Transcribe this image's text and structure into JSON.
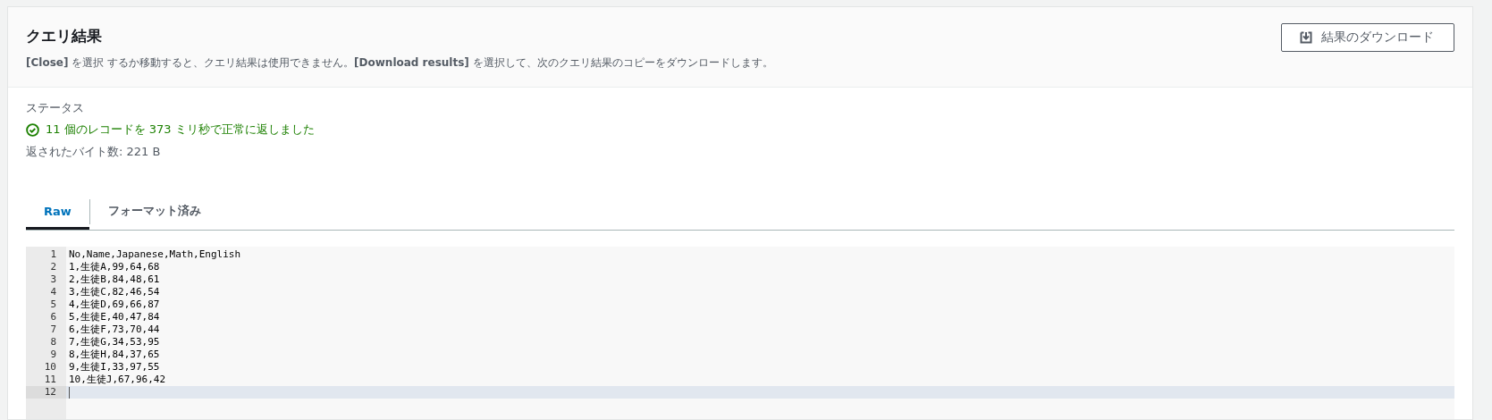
{
  "header": {
    "title": "クエリ結果",
    "description": "**[Close]** を選択 するか移動すると、クエリ結果は使用できません。**[Download results]** を選択して、次のクエリ結果のコピーをダウンロードします。",
    "download_button": "結果のダウンロード"
  },
  "status": {
    "label": "ステータス",
    "message": "11 個のレコードを 373 ミリ秒で正常に返しました",
    "success": true,
    "bytes": "返されたバイト数: 221 B"
  },
  "tabs": [
    {
      "label": "Raw",
      "selected": true
    },
    {
      "label": "フォーマット済み",
      "selected": false
    }
  ],
  "editor": {
    "lines": [
      {
        "number": "1",
        "text": "No,Name,Japanese,Math,English",
        "active": false
      },
      {
        "number": "2",
        "text": "1,生徒A,99,64,68",
        "active": false
      },
      {
        "number": "3",
        "text": "2,生徒B,84,48,61",
        "active": false
      },
      {
        "number": "4",
        "text": "3,生徒C,82,46,54",
        "active": false
      },
      {
        "number": "5",
        "text": "4,生徒D,69,66,87",
        "active": false
      },
      {
        "number": "6",
        "text": "5,生徒E,40,47,84",
        "active": false
      },
      {
        "number": "7",
        "text": "6,生徒F,73,70,44",
        "active": false
      },
      {
        "number": "8",
        "text": "7,生徒G,34,53,95",
        "active": false
      },
      {
        "number": "9",
        "text": "8,生徒H,84,37,65",
        "active": false
      },
      {
        "number": "10",
        "text": "9,生徒I,33,97,55",
        "active": false
      },
      {
        "number": "11",
        "text": "10,生徒J,67,96,42",
        "active": false
      },
      {
        "number": "12",
        "active": true
      }
    ]
  }
}
